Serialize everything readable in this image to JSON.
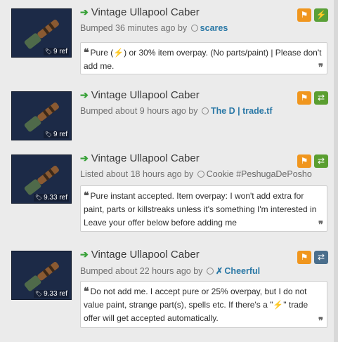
{
  "listings": [
    {
      "title": "Vintage Ullapool Caber",
      "price": "9 ref",
      "status_prefix": "Bumped 36 minutes ago by",
      "user": "scares",
      "comment": "Pure (⚡) or 30% item overpay. (No parts/paint) | Please don't add me.",
      "action_icon": "lightning-icon"
    },
    {
      "title": "Vintage Ullapool Caber",
      "price": "9 ref",
      "status_prefix": "Bumped about 9 hours ago by",
      "user": "The D | trade.tf",
      "comment": "",
      "action_icon": "trade-icon"
    },
    {
      "title": "Vintage Ullapool Caber",
      "price": "9.33 ref",
      "status_prefix": "Listed about 18 hours ago by",
      "user": "Cookie #PeshugaDePosho",
      "comment": "Pure instant accepted. Item overpay: I won't add extra for paint, parts or killstreaks unless it's something I'm interested in Leave your offer below before adding me",
      "action_icon": "trade-icon"
    },
    {
      "title": "Vintage Ullapool Caber",
      "price": "9.33 ref",
      "status_prefix": "Bumped about 22 hours ago by",
      "user": "Cheerful",
      "user_prefix": "✗",
      "comment": "Do not add me. I accept pure or 25% overpay, but I do not value paint, strange part(s), spells etc. If there's a \"⚡\" trade offer will get accepted automatically.",
      "action_icon": "trade-icon"
    }
  ],
  "colors": {
    "flag_button": "#f0961e",
    "lightning_button": "#5aa038",
    "trade_button_green": "#5a9e30",
    "trade_button_blue": "#4a6e8c",
    "username": "#2a78a6",
    "title_arrow": "#3aa23a"
  }
}
